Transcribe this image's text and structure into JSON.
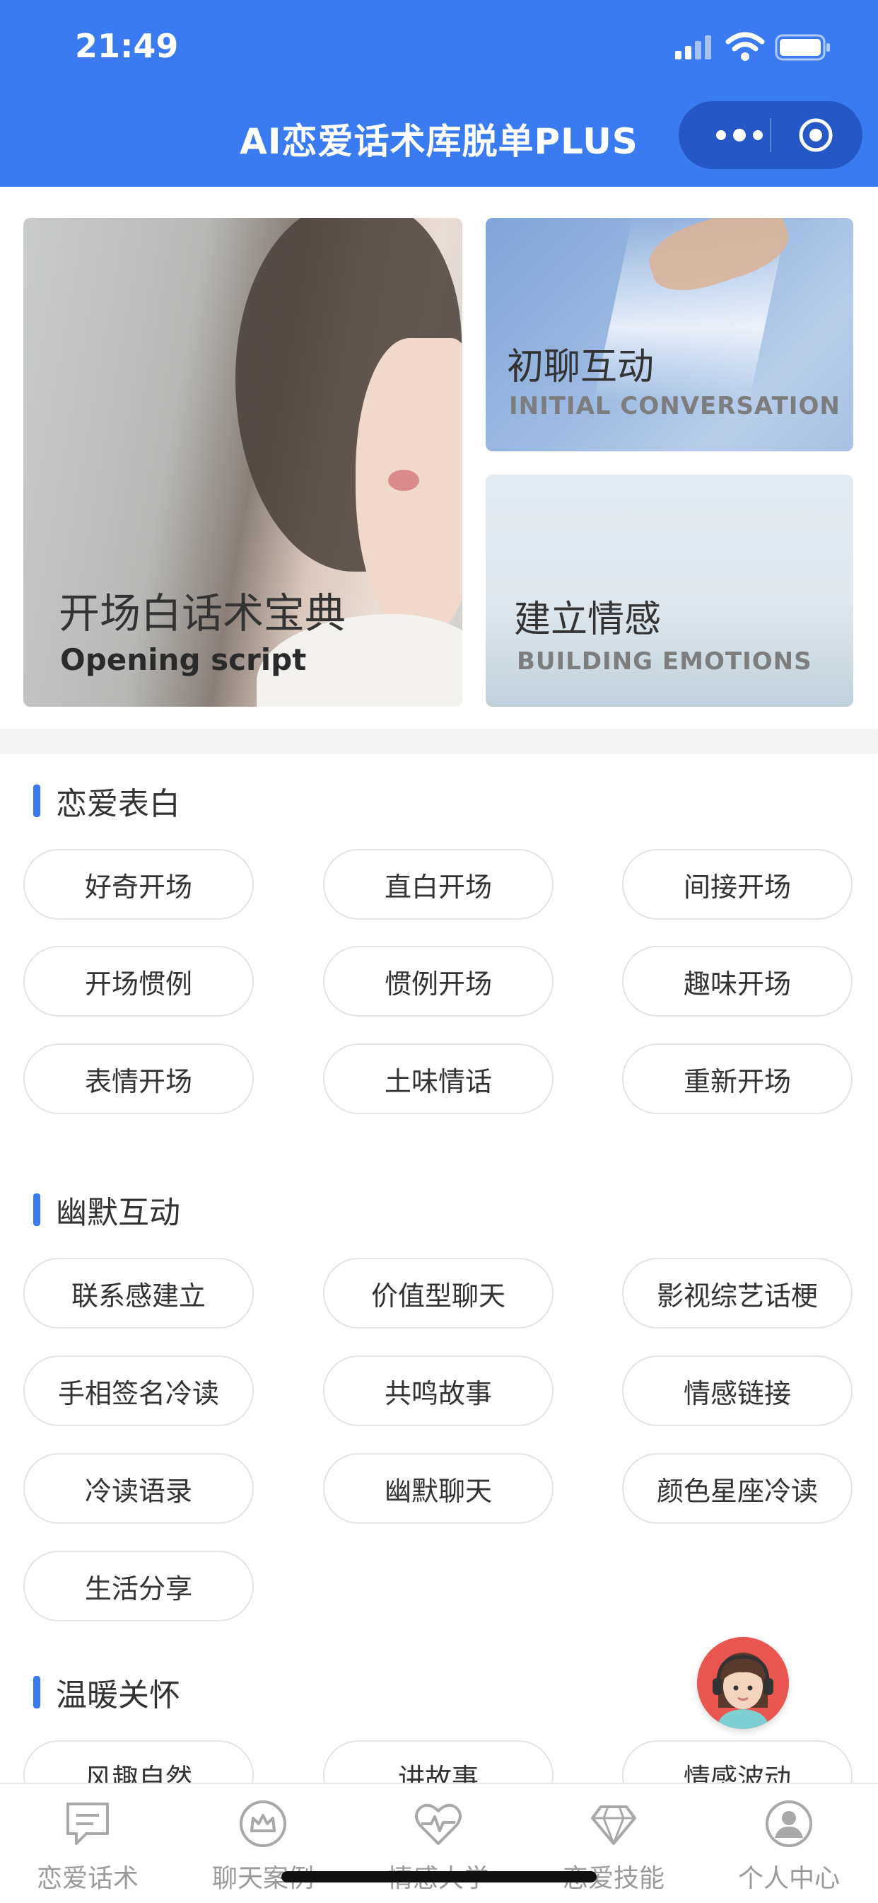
{
  "status": {
    "time": "21:49"
  },
  "header": {
    "title": "AI恋爱话术库脱单PLUS"
  },
  "banners": {
    "main": {
      "title": "开场白话术宝典",
      "subtitle": "Opening script"
    },
    "top": {
      "title": "初聊互动",
      "subtitle": "INITIAL CONVERSATION"
    },
    "bottom": {
      "title": "建立情感",
      "subtitle": "BUILDING EMOTIONS"
    }
  },
  "sections": [
    {
      "title": "恋爱表白",
      "tags": [
        "好奇开场",
        "直白开场",
        "间接开场",
        "开场惯例",
        "惯例开场",
        "趣味开场",
        "表情开场",
        "土味情话",
        "重新开场"
      ]
    },
    {
      "title": "幽默互动",
      "tags": [
        "联系感建立",
        "价值型聊天",
        "影视综艺话梗",
        "手相签名冷读",
        "共鸣故事",
        "情感链接",
        "冷读语录",
        "幽默聊天",
        "颜色星座冷读",
        "生活分享"
      ]
    },
    {
      "title": "温暖关怀",
      "tags": [
        "风趣自然",
        "讲故事",
        "情感波动"
      ]
    }
  ],
  "tabbar": [
    {
      "label": "恋爱话术",
      "icon": "chat-bubble-icon"
    },
    {
      "label": "聊天案例",
      "icon": "crown-icon"
    },
    {
      "label": "情感大学",
      "icon": "heartbeat-icon"
    },
    {
      "label": "恋爱技能",
      "icon": "diamond-icon"
    },
    {
      "label": "个人中心",
      "icon": "user-icon"
    }
  ],
  "colors": {
    "primary": "#3a7bf2",
    "capsule": "#2558c6",
    "customer_service": "#e8564f"
  }
}
